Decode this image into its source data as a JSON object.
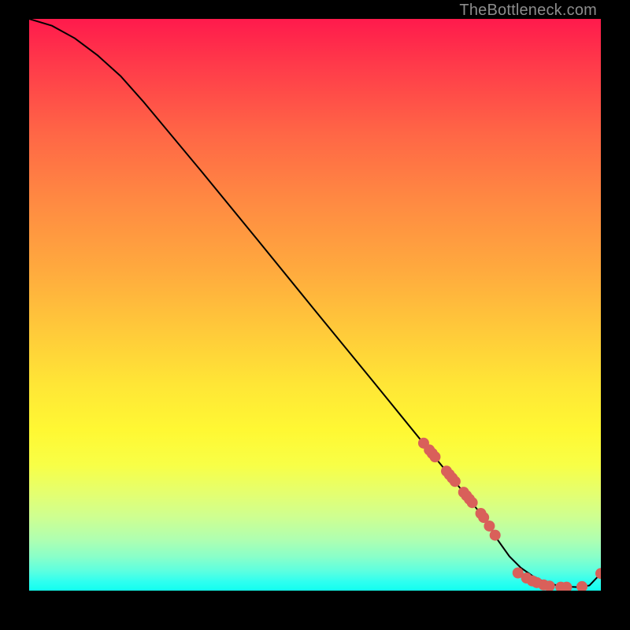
{
  "watermark": "TheBottleneck.com",
  "chart_data": {
    "type": "line",
    "title": "",
    "xlabel": "",
    "ylabel": "",
    "xlim": [
      0,
      100
    ],
    "ylim": [
      0,
      100
    ],
    "background_gradient": {
      "direction": "vertical",
      "stops": [
        {
          "pct": 0,
          "color": "#ff1a4c"
        },
        {
          "pct": 50,
          "color": "#ffc83a"
        },
        {
          "pct": 80,
          "color": "#f3ff55"
        },
        {
          "pct": 100,
          "color": "#12ffef"
        }
      ]
    },
    "series": [
      {
        "name": "bottleneck-curve",
        "x": [
          0,
          4,
          8,
          12,
          16,
          20,
          30,
          40,
          50,
          60,
          70,
          75,
          80,
          82,
          84,
          86,
          88,
          90,
          92,
          94,
          96,
          98,
          100
        ],
        "y": [
          100,
          98.8,
          96.6,
          93.6,
          90,
          85.5,
          73.5,
          61.3,
          49,
          36.8,
          24.5,
          18.4,
          12.2,
          8.8,
          6,
          4,
          2.6,
          1.6,
          1.0,
          0.7,
          0.6,
          0.9,
          3.0
        ],
        "color": "#000000",
        "stroke_width": 2
      }
    ],
    "scatter_points": {
      "name": "highlight-dots",
      "color": "#d9605a",
      "radius": 7,
      "points": [
        {
          "x": 69,
          "y": 25.8
        },
        {
          "x": 70,
          "y": 24.6
        },
        {
          "x": 70.5,
          "y": 24.0
        },
        {
          "x": 71,
          "y": 23.4
        },
        {
          "x": 73,
          "y": 20.9
        },
        {
          "x": 73.5,
          "y": 20.3
        },
        {
          "x": 74,
          "y": 19.7
        },
        {
          "x": 74.5,
          "y": 19.1
        },
        {
          "x": 76,
          "y": 17.2
        },
        {
          "x": 76.5,
          "y": 16.6
        },
        {
          "x": 77,
          "y": 16.0
        },
        {
          "x": 77.5,
          "y": 15.4
        },
        {
          "x": 79,
          "y": 13.5
        },
        {
          "x": 79.5,
          "y": 12.8
        },
        {
          "x": 80.5,
          "y": 11.3
        },
        {
          "x": 81.5,
          "y": 9.7
        },
        {
          "x": 85.5,
          "y": 3.1
        },
        {
          "x": 87,
          "y": 2.2
        },
        {
          "x": 88,
          "y": 1.7
        },
        {
          "x": 88.8,
          "y": 1.4
        },
        {
          "x": 90,
          "y": 1.0
        },
        {
          "x": 91,
          "y": 0.8
        },
        {
          "x": 93,
          "y": 0.6
        },
        {
          "x": 94,
          "y": 0.6
        },
        {
          "x": 96.7,
          "y": 0.7
        },
        {
          "x": 100,
          "y": 3.0
        }
      ]
    }
  }
}
